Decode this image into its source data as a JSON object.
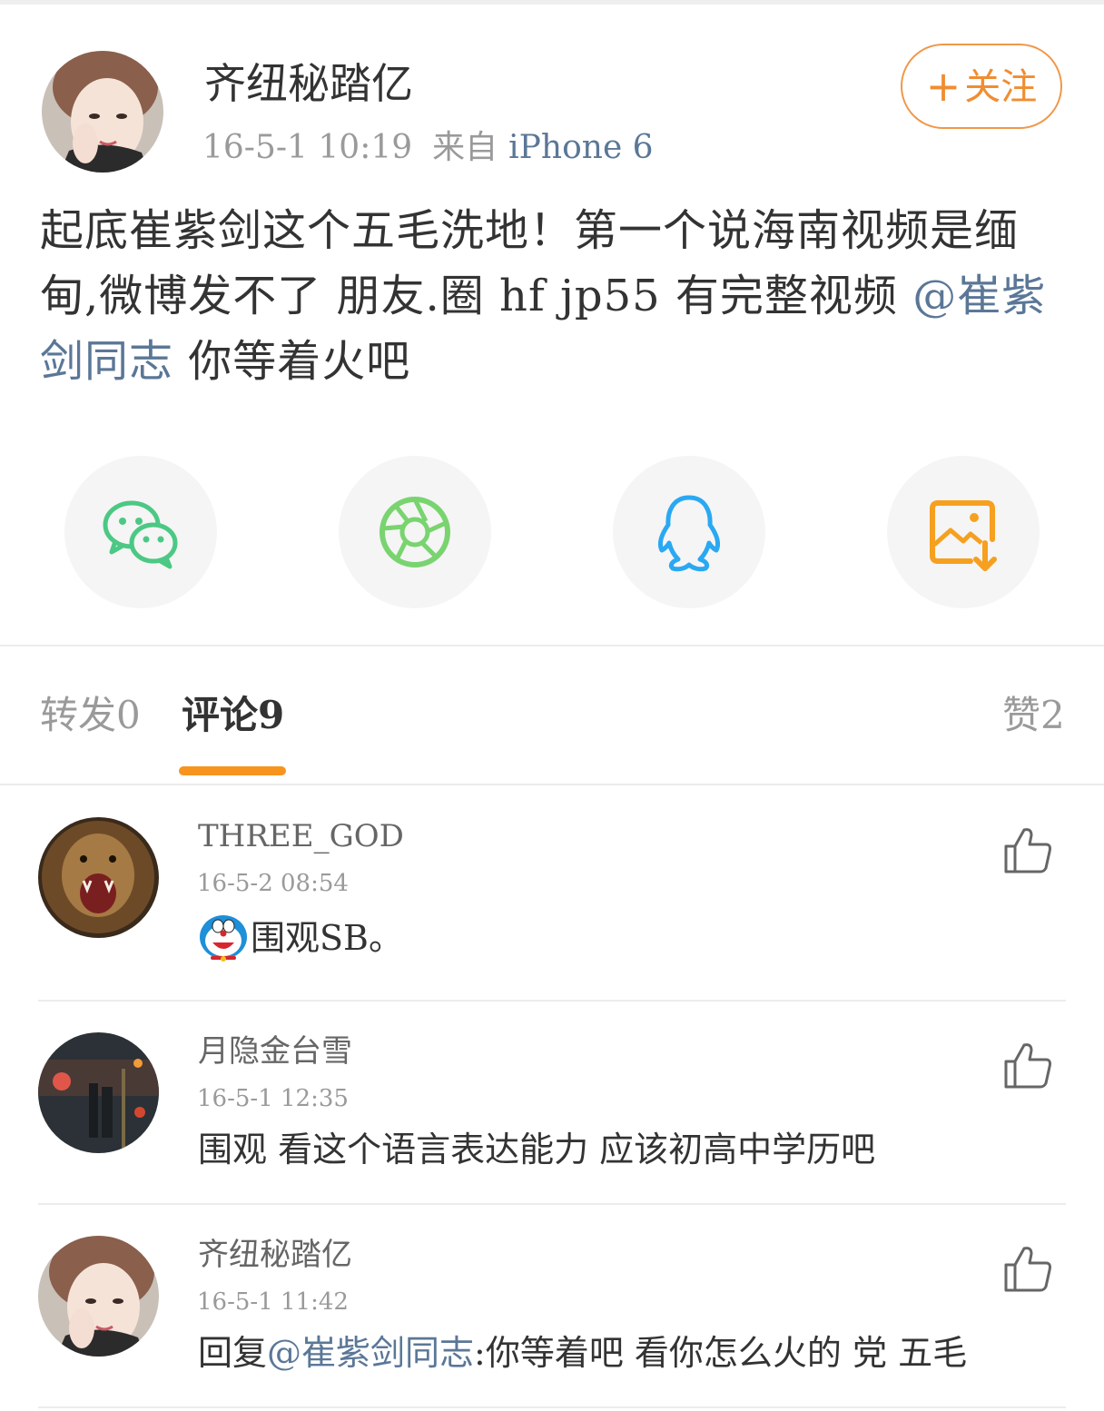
{
  "post": {
    "author": "齐纽秘踏亿",
    "timestamp": "16-5-1 10:19",
    "source_prefix": "来自",
    "source_device": "iPhone 6",
    "follow_label": "关注",
    "text_main": "起底崔紫剑这个五毛洗地！第一个说海南视频是缅甸,微博发不了 朋友.圈 hf jp55 有完整视频 ",
    "text_mention": "@崔紫剑同志",
    "text_tail": " 你等着火吧"
  },
  "share": {
    "items": [
      {
        "icon": "wechat-icon",
        "color": "#4cc885"
      },
      {
        "icon": "moments-icon",
        "color": "#79d46f"
      },
      {
        "icon": "qq-icon",
        "color": "#2aa8f2"
      },
      {
        "icon": "save-image-icon",
        "color": "#f6a020"
      }
    ]
  },
  "tabs": {
    "repost": "转发0",
    "comments": "评论9",
    "likes": "赞2",
    "accent_color": "#f7941d"
  },
  "comments": [
    {
      "user": "THREE_GOD",
      "time": "16-5-2 08:54",
      "emoji": "doraemon-emoji",
      "text": "围观SB。"
    },
    {
      "user": "月隐金台雪",
      "time": "16-5-1 12:35",
      "text": "围观 看这个语言表达能力 应该初高中学历吧"
    },
    {
      "user": "齐纽秘踏亿",
      "time": "16-5-1 11:42",
      "text_prefix": "回复",
      "mention": "@崔紫剑同志",
      "text_rest": ":你等着吧 看你怎么火的 党 五毛"
    }
  ]
}
